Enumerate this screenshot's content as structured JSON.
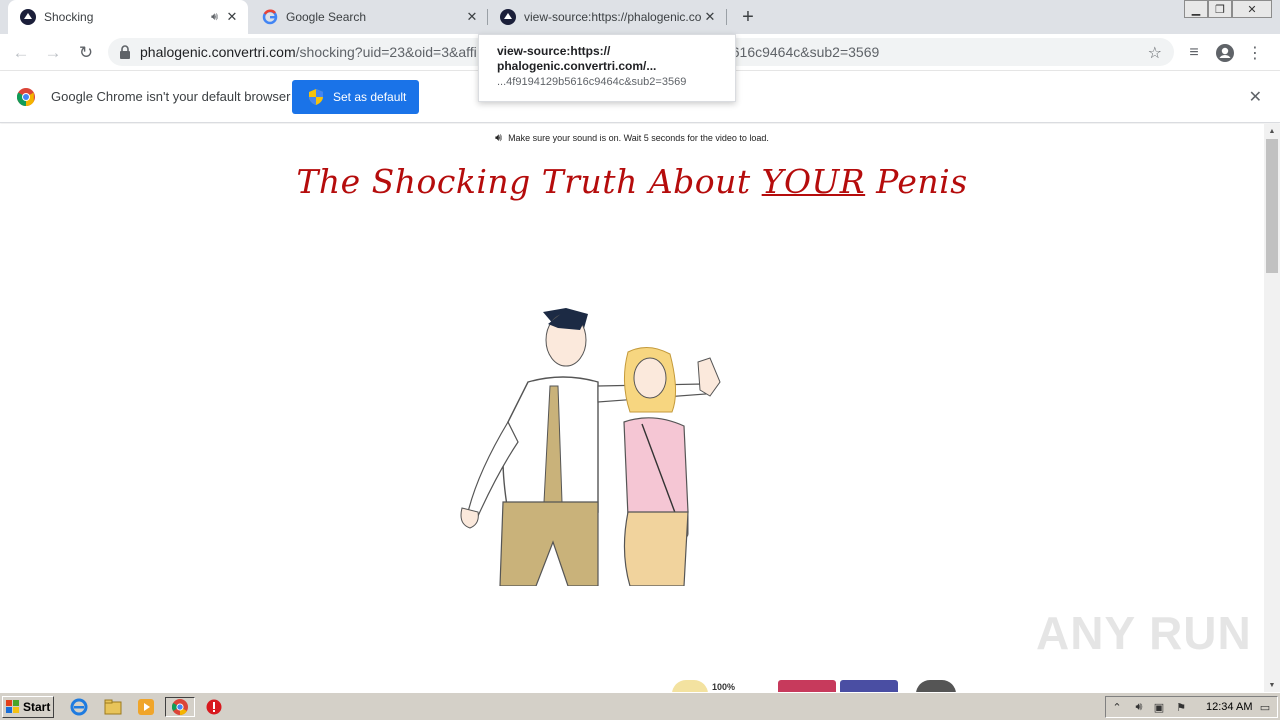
{
  "browser": {
    "tabs": [
      {
        "title": "Shocking",
        "active": true
      },
      {
        "title": "Google Search",
        "active": false
      },
      {
        "title": "view-source:https://phalogenic.conv",
        "active": false
      }
    ],
    "url": {
      "host": "phalogenic.convertri.com",
      "path": "/shocking?uid=23&oid=3&affi",
      "tail": "616c9464c&sub2=3569"
    },
    "tooltip": {
      "line1": "view-source:https://",
      "line2": "phalogenic.convertri.com/...",
      "line3": "...4f9194129b5616c9464c&sub2=3569"
    },
    "infobar": {
      "message": "Google Chrome isn't your default browser",
      "button": "Set as default"
    }
  },
  "page": {
    "sound_notice": "Make sure your sound is on. Wait 5 seconds for the video to load.",
    "headline_pre": "The Shocking Truth About ",
    "headline_em": "YOUR",
    "headline_post": " Penis",
    "badge_text": "100%"
  },
  "taskbar": {
    "start": "Start",
    "clock": "12:34 AM"
  },
  "watermark": "ANY RUN",
  "colors": {
    "headline": "#b50c0c",
    "infobar_button": "#1a73e8"
  }
}
